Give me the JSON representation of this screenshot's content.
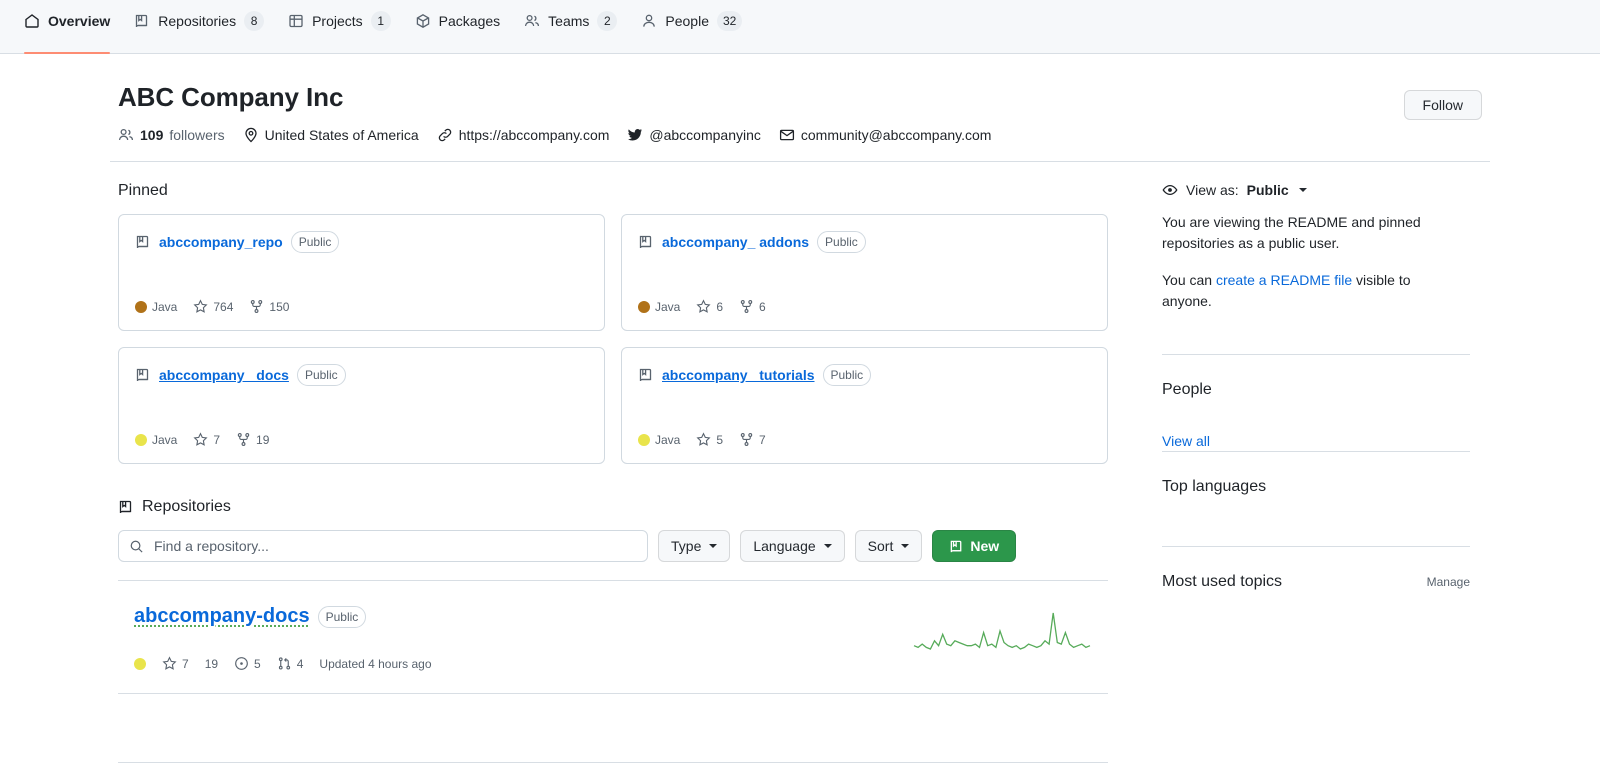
{
  "nav": {
    "items": [
      {
        "label": "Overview",
        "icon": "home-icon",
        "count": null,
        "active": true
      },
      {
        "label": "Repositories",
        "icon": "repo-icon",
        "count": "8",
        "active": false
      },
      {
        "label": "Projects",
        "icon": "project-icon",
        "count": "1",
        "active": false
      },
      {
        "label": "Packages",
        "icon": "package-icon",
        "count": null,
        "active": false
      },
      {
        "label": "Teams",
        "icon": "people-icon",
        "count": "2",
        "active": false
      },
      {
        "label": "People",
        "icon": "person-icon",
        "count": "32",
        "active": false
      }
    ],
    "active_underline_color": "#fd8c73"
  },
  "org": {
    "name": "ABC Company Inc",
    "followers_count": "109",
    "followers_label": "followers",
    "location": "United States of America",
    "website": "https://abccompany.com",
    "twitter": "@abccompanyinc",
    "email": "community@abccompany.com",
    "follow_button": "Follow"
  },
  "pinned": {
    "title": "Pinned",
    "cards": [
      {
        "name": "abccompany_repo",
        "visibility": "Public",
        "language": "Java",
        "language_color": "#b07219",
        "stars": "764",
        "forks": "150",
        "hovered": false
      },
      {
        "name": "abccompany_ addons",
        "visibility": "Public",
        "language": "Java",
        "language_color": "#b07219",
        "stars": "6",
        "forks": "6",
        "hovered": false
      },
      {
        "name": "abccompany_ docs",
        "visibility": "Public",
        "language": "Java",
        "language_color": "#e9e44b",
        "stars": "7",
        "forks": "19",
        "hovered": true
      },
      {
        "name": "abccompany_ tutorials",
        "visibility": "Public",
        "language": "Java",
        "language_color": "#e9e44b",
        "stars": "5",
        "forks": "7",
        "hovered": true
      }
    ]
  },
  "repositories": {
    "title": "Repositories",
    "search_placeholder": "Find a repository...",
    "search_value": "",
    "filters": [
      {
        "label": "Type"
      },
      {
        "label": "Language"
      },
      {
        "label": "Sort"
      }
    ],
    "new_button": "New",
    "new_button_color": "#2c974b",
    "rows": [
      {
        "name": "abccompany-docs",
        "visibility": "Public",
        "language_color": "#e9e44b",
        "stars": "7",
        "forks": "19",
        "issues": "5",
        "pull_requests": "4",
        "updated": "Updated 4 hours ago",
        "sparkline_color": "#57ab5a",
        "sparkline": [
          6,
          5,
          7,
          5,
          4,
          9,
          6,
          13,
          7,
          6,
          9,
          8,
          7,
          6,
          6,
          7,
          5,
          14,
          6,
          7,
          5,
          15,
          8,
          6,
          5,
          6,
          4,
          5,
          7,
          6,
          5,
          6,
          9,
          7,
          26,
          8,
          7,
          14,
          7,
          5,
          6,
          7,
          5,
          6
        ]
      }
    ]
  },
  "sidebar": {
    "view_as": {
      "label": "View as:",
      "value": "Public"
    },
    "readme_notice": "You are viewing the README and pinned repositories as a public user.",
    "create_readme_prefix": "You can ",
    "create_readme_link": "create a README file",
    "create_readme_suffix": " visible to anyone.",
    "people": {
      "title": "People",
      "view_all": "View all"
    },
    "top_languages": {
      "title": "Top languages"
    },
    "most_used_topics": {
      "title": "Most used topics",
      "manage": "Manage"
    }
  }
}
